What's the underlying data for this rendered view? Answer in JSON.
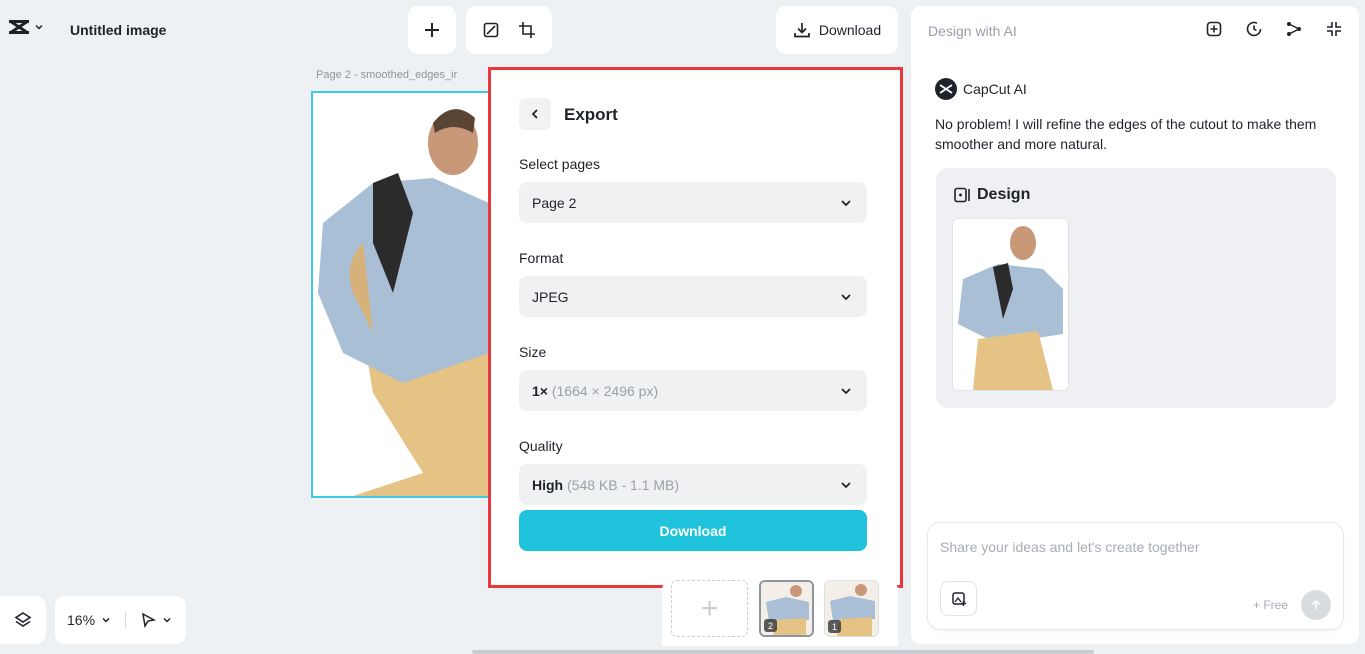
{
  "app": {
    "logo_icon": "capcut-logo-icon",
    "doc_title": "Untitled image"
  },
  "toolbar": {
    "add_icon": "plus-icon",
    "icons": [
      "resize-icon",
      "crop-icon"
    ],
    "download_label": "Download"
  },
  "canvas": {
    "page_label": "Page 2 -  smoothed_edges_ir"
  },
  "export": {
    "title": "Export",
    "select_pages_label": "Select pages",
    "select_pages_value": "Page 2",
    "format_label": "Format",
    "format_value": "JPEG",
    "size_label": "Size",
    "size_value": "1×",
    "size_detail": "(1664 × 2496 px)",
    "quality_label": "Quality",
    "quality_value": "High",
    "quality_detail": "(548 KB - 1.1 MB)",
    "download_label": "Download"
  },
  "bottom": {
    "zoom": "16%",
    "pages": [
      {
        "number": "2",
        "selected": true
      },
      {
        "number": "1",
        "selected": false
      }
    ]
  },
  "ai_panel": {
    "header_title": "Design with AI",
    "header_icons": [
      "new-chat-icon",
      "history-icon",
      "share-icon",
      "collapse-icon"
    ],
    "brand": "CapCut AI",
    "message": "No problem! I will refine the edges of the cutout to make them smoother and more natural.",
    "design_title": "Design",
    "chat_placeholder": "Share your ideas and let's create together",
    "free_label": "+ Free"
  },
  "colors": {
    "accent": "#1fc3db",
    "highlight_border": "#e8383b",
    "canvas_border": "#3fc9e4"
  }
}
